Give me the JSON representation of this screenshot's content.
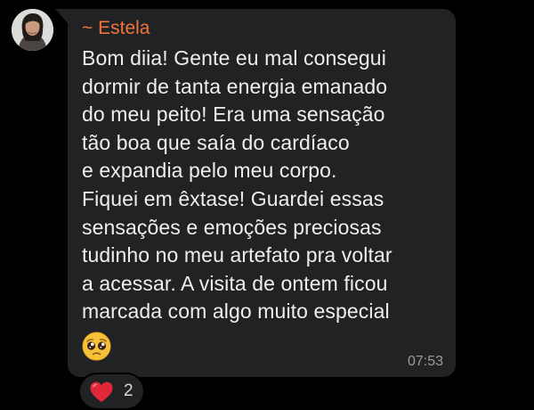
{
  "chat": {
    "sender": {
      "name": "~ Estela",
      "name_trailing_fragment": " ",
      "name_color": "#f0753c",
      "avatar_icon": "user-avatar"
    },
    "message": {
      "text": "Bom diia! Gente eu mal consegui\ndormir de tanta energia emanado\ndo meu peito! Era uma sensação\ntão boa que saía do cardíaco\ne expandia pelo meu corpo.\nFiquei em êxtase! Guardei essas\nsensações e emoções preciosas\ntudinho no meu artefato pra voltar\na acessar. A visita de ontem ficou\nmarcada com algo muito especial",
      "trailing_emoji": "pleading-face-emoji",
      "time": "07:53"
    },
    "reactions": {
      "emoji_icon": "red-heart-emoji",
      "count": "2"
    },
    "colors": {
      "background": "#000000",
      "bubble": "#212224",
      "text": "#eeeeee",
      "time": "#9a9b9d",
      "heart": "#e0283a"
    }
  }
}
